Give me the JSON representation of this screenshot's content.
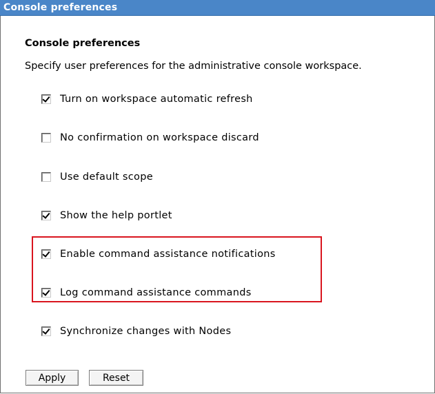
{
  "window": {
    "title": "Console preferences"
  },
  "section": {
    "heading": "Console preferences",
    "description": "Specify user preferences for the administrative console workspace."
  },
  "preferences": [
    {
      "label": "Turn on workspace automatic refresh",
      "checked": true
    },
    {
      "label": "No confirmation on workspace discard",
      "checked": false
    },
    {
      "label": "Use default scope",
      "checked": false
    },
    {
      "label": "Show the help portlet",
      "checked": true
    },
    {
      "label": "Enable command assistance notifications",
      "checked": true,
      "highlighted": true
    },
    {
      "label": "Log command assistance commands",
      "checked": true,
      "highlighted": true
    },
    {
      "label": "Synchronize changes with Nodes",
      "checked": true
    }
  ],
  "buttons": {
    "apply": "Apply",
    "reset": "Reset"
  },
  "colors": {
    "titlebar": "#4a86c8",
    "titlebar_text": "#ffffff",
    "highlight_border": "#d9141e"
  }
}
